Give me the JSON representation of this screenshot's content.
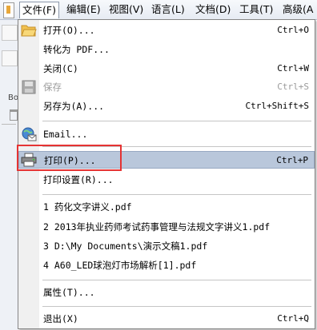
{
  "menubar": {
    "items": [
      {
        "label": "文件(F)",
        "active": true
      },
      {
        "label": "编辑(E)"
      },
      {
        "label": "视图(V)"
      },
      {
        "label": "语言(L)"
      },
      {
        "label": "文档(D)"
      },
      {
        "label": "工具(T)"
      },
      {
        "label": "高级(A"
      }
    ]
  },
  "background": {
    "bo_text": "Bo"
  },
  "file_menu": {
    "open": {
      "label": "打开(O)...",
      "shortcut": "Ctrl+O",
      "icon": "folder-open-icon"
    },
    "convert_pdf": {
      "label": "转化为 PDF..."
    },
    "close": {
      "label": "关闭(C)",
      "shortcut": "Ctrl+W"
    },
    "save": {
      "label": "保存",
      "shortcut": "Ctrl+S",
      "disabled": true,
      "icon": "floppy-disk-icon"
    },
    "save_as": {
      "label": "另存为(A)...",
      "shortcut": "Ctrl+Shift+S"
    },
    "email": {
      "label": "Email...",
      "icon": "email-globe-icon"
    },
    "print": {
      "label": "打印(P)...",
      "shortcut": "Ctrl+P",
      "highlighted": true,
      "icon": "printer-icon"
    },
    "print_setup": {
      "label": "打印设置(R)..."
    },
    "recent_files": [
      "1 药化文字讲义.pdf",
      "2 2013年执业药师考试药事管理与法规文字讲义1.pdf",
      "3 D:\\My Documents\\演示文稿1.pdf",
      "4 A60_LED球泡灯市场解析[1].pdf"
    ],
    "properties": {
      "label": "属性(T)..."
    },
    "exit": {
      "label": "退出(X)",
      "shortcut": "Ctrl+Q"
    }
  },
  "colors": {
    "highlight": "#b9c7db",
    "annotation_box": "#e53333"
  }
}
